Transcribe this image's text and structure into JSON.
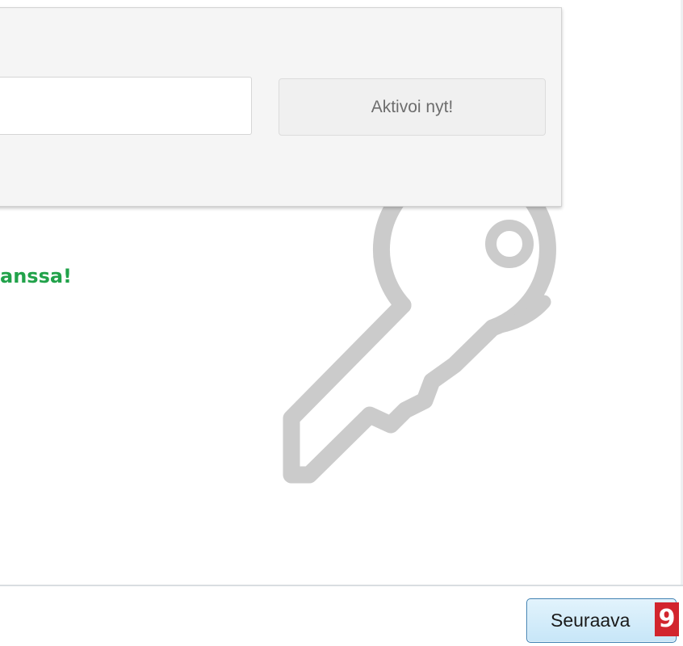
{
  "activation": {
    "license_input_value": "",
    "activate_label": "Aktivoi nyt!"
  },
  "status": {
    "message_visible": "anssa!",
    "color": "#21a24a"
  },
  "footer": {
    "next_label": "Seuraava"
  },
  "annotation": {
    "step_number": "9",
    "color": "#d2252d"
  },
  "icons": {
    "key": "key-icon"
  }
}
